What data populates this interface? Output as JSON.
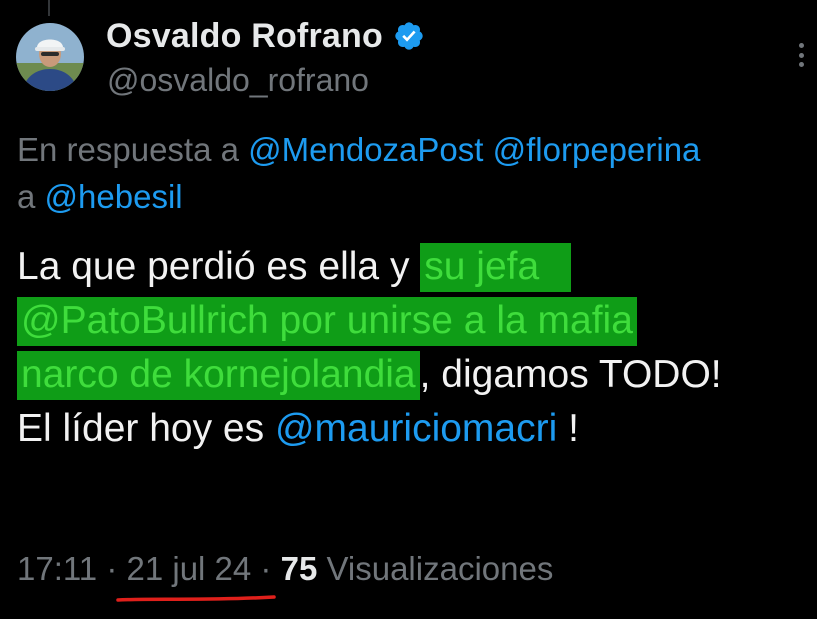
{
  "author": {
    "display_name": "Osvaldo Rofrano",
    "handle": "@osvaldo_rofrano",
    "verified": true,
    "avatar": "avatar"
  },
  "reply_context": {
    "prefix": "En respuesta a",
    "mentions": [
      "@MendozaPost",
      "@florpeperina"
    ],
    "joiner": "a",
    "mention_last": "@hebesil"
  },
  "tweet": {
    "t1": "La que perdió es ella y ",
    "h1": "su jefa",
    "h2_mention": "@PatoBullrich",
    "h2_rest": " por unirse a la mafia",
    "h3": "narco de kornejolandia",
    "t2": ", digamos TODO!",
    "t3": "El líder hoy es ",
    "mention": "@mauriciomacri",
    "t4": " !"
  },
  "meta": {
    "time": "17:11",
    "sep": "·",
    "date": "21 jul 24",
    "views_count": "75",
    "views_label": "Visualizaciones"
  },
  "colors": {
    "background": "#000000",
    "text": "#e7e9ea",
    "secondary": "#71767b",
    "link": "#1d9bf0",
    "highlight_bg": "#0f9d17",
    "highlight_text": "#3fdd3c",
    "underline_mark": "#e0201b",
    "verified": "#1d9bf0"
  },
  "icons": [
    "verified-badge-icon",
    "more-options-icon"
  ]
}
